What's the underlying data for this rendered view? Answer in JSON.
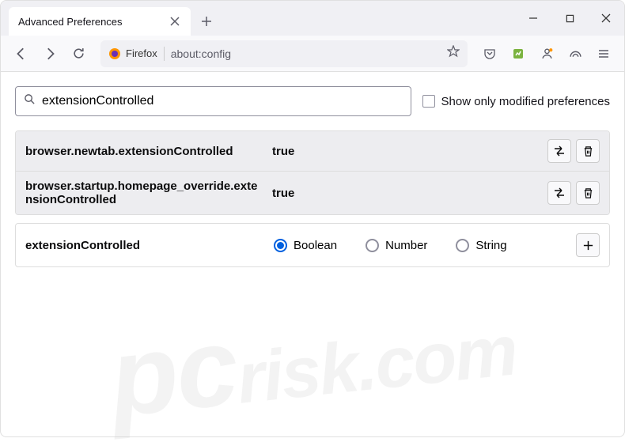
{
  "tab": {
    "title": "Advanced Preferences"
  },
  "addressbar": {
    "badge": "Firefox",
    "url": "about:config"
  },
  "search": {
    "value": "extensionControlled",
    "checkbox_label": "Show only modified preferences"
  },
  "preferences": [
    {
      "name": "browser.newtab.extensionControlled",
      "value": "true"
    },
    {
      "name": "browser.startup.homepage_override.extensionControlled",
      "value": "true"
    }
  ],
  "new_pref": {
    "name": "extensionControlled",
    "types": [
      "Boolean",
      "Number",
      "String"
    ],
    "selected": "Boolean"
  },
  "watermark": {
    "pc": "pc",
    "rest": "risk.com"
  }
}
